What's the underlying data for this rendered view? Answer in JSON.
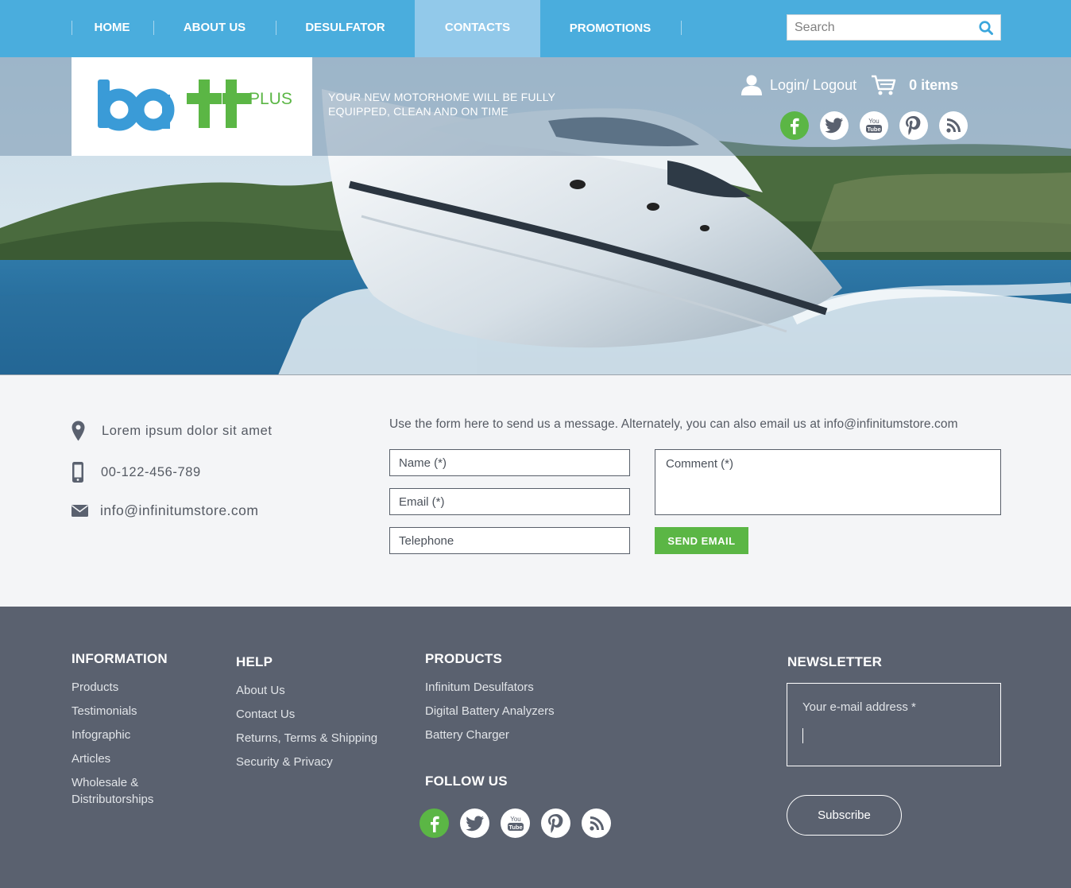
{
  "nav": {
    "items": [
      {
        "label": "HOME"
      },
      {
        "label": "ABOUT US"
      },
      {
        "label": "DESULFATOR"
      },
      {
        "label": "CONTACTS",
        "active": true
      },
      {
        "label": "PROMOTIONS"
      }
    ],
    "search_placeholder": "Search"
  },
  "header": {
    "logo_text_plus": "PLUS",
    "tagline": "YOUR NEW MOTORHOME WILL BE FULLY EQUIPPED, CLEAN AND ON TIME",
    "login_label": "Login/ Logout",
    "cart_label": "0 items",
    "social": [
      "facebook-icon",
      "twitter-icon",
      "youtube-icon",
      "pinterest-icon",
      "rss-icon"
    ]
  },
  "contact": {
    "address": "Lorem ipsum dolor sit amet",
    "phone": "00-122-456-789",
    "email": "info@infinitumstore.com",
    "intro": "Use the form here to send us a message. Alternately, you can also email us at info@infinitumstore.com",
    "name_placeholder": "Name (*)",
    "email_placeholder": "Email (*)",
    "phone_placeholder": "Telephone",
    "comment_placeholder": "Comment (*)",
    "send_label": "SEND EMAIL"
  },
  "footer": {
    "information": {
      "title": "INFORMATION",
      "links": [
        "Products",
        "Testimonials",
        "Infographic",
        "Articles",
        "Wholesale &",
        "Distributorships"
      ]
    },
    "help": {
      "title": "HELP",
      "links": [
        "About Us",
        "Contact Us",
        "Returns, Terms & Shipping",
        "Security & Privacy"
      ]
    },
    "products": {
      "title": "PRODUCTS",
      "links": [
        "Infinitum Desulfators",
        "Digital Battery Analyzers",
        "Battery Charger"
      ]
    },
    "follow_title": "FOLLOW US",
    "newsletter": {
      "title": "NEWSLETTER",
      "email_label": "Your e-mail address *",
      "subscribe_label": "Subscribe"
    }
  },
  "colors": {
    "nav_bg": "#4aaddd",
    "nav_active": "#92c9ea",
    "accent_green": "#5bb645",
    "logo_blue": "#3a9bd7",
    "footer_bg": "#5a616f"
  }
}
